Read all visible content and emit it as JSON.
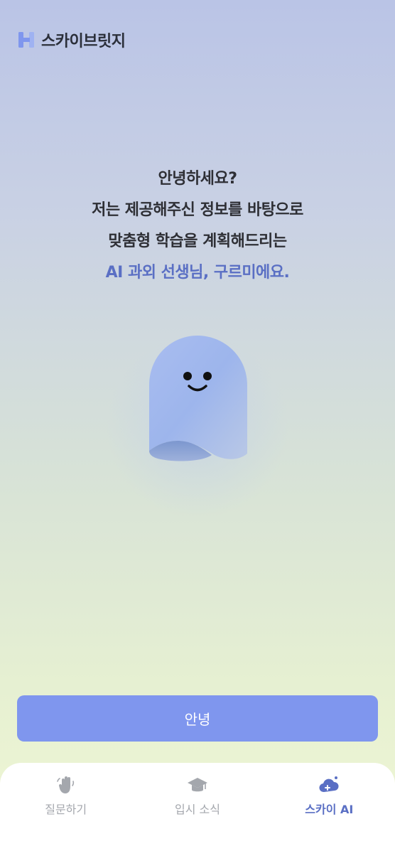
{
  "brand": {
    "name": "스카이브릿지",
    "icon": "h-logo-icon",
    "color": "#7f96ee"
  },
  "greeting": {
    "line1": "안녕하세요?",
    "line2": "저는 제공해주신 정보를 바탕으로",
    "line3": "맞춤형 학습을 계획해드리는",
    "line4": "AI 과외 선생님, 구르미에요."
  },
  "mascot": {
    "icon": "ghost-cloud-mascot"
  },
  "cta": {
    "label": "안녕"
  },
  "tabs": [
    {
      "label": "질문하기",
      "icon": "raised-hand-icon",
      "active": false
    },
    {
      "label": "입시 소식",
      "icon": "graduation-cap-icon",
      "active": false
    },
    {
      "label": "스카이 AI",
      "icon": "cloud-plus-icon",
      "active": true
    }
  ],
  "colors": {
    "accent": "#5a6fc4",
    "button": "#7f96ee",
    "inactive": "#a4a7ad"
  }
}
